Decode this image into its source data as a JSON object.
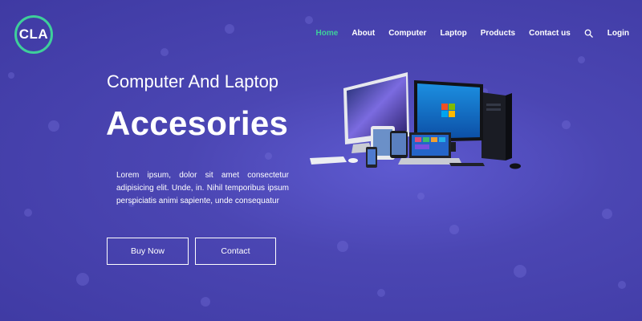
{
  "brand": {
    "logo_text": "CLA",
    "accent_color": "#3ecf9a",
    "background_color": "#4b46b3"
  },
  "nav": {
    "items": [
      {
        "label": "Home",
        "active": true
      },
      {
        "label": "About"
      },
      {
        "label": "Computer"
      },
      {
        "label": "Laptop"
      },
      {
        "label": "Products"
      },
      {
        "label": "Contact us"
      }
    ],
    "search_icon": "search-icon",
    "login_label": "Login"
  },
  "hero": {
    "subtitle": "Computer And Laptop",
    "title": "Accesories",
    "description": "Lorem ipsum, dolor sit amet consectetur adipisicing elit. Unde, in. Nihil temporibus ipsum perspiciatis animi sapiente, unde consequatur",
    "buy_button": "Buy Now",
    "contact_button": "Contact"
  }
}
